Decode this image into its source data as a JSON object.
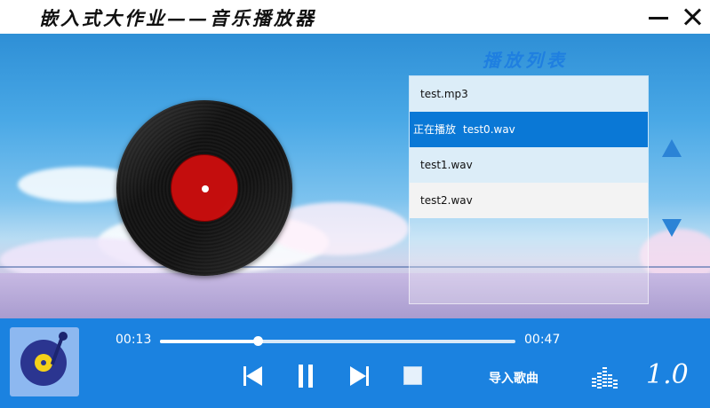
{
  "window": {
    "title": "嵌入式大作业——音乐播放器"
  },
  "playlist": {
    "title": "播放列表",
    "items": [
      {
        "label": "test.mp3",
        "prefix": ""
      },
      {
        "label": "test0.wav",
        "prefix": "正在播放"
      },
      {
        "label": "test1.wav",
        "prefix": ""
      },
      {
        "label": "test2.wav",
        "prefix": ""
      }
    ],
    "active_index": 1
  },
  "player": {
    "current_time": "00:13",
    "total_time": "00:47",
    "progress_fraction": 0.276,
    "import_label": "导入歌曲",
    "version_label": "1.0"
  },
  "icons": {
    "minimize": "minimize-icon",
    "close": "close-icon",
    "prev": "skip-previous-icon",
    "pause": "pause-icon",
    "next": "skip-next-icon",
    "stop": "stop-icon",
    "equalizer": "equalizer-icon",
    "scroll_up": "triangle-up-icon",
    "scroll_down": "triangle-down-icon",
    "vinyl": "vinyl-record-icon",
    "album": "turntable-icon"
  },
  "colors": {
    "accent": "#1b82e0",
    "active_row": "#0a78d6",
    "vinyl_label": "#c40d0d",
    "playlist_title": "#1f7fe0"
  }
}
